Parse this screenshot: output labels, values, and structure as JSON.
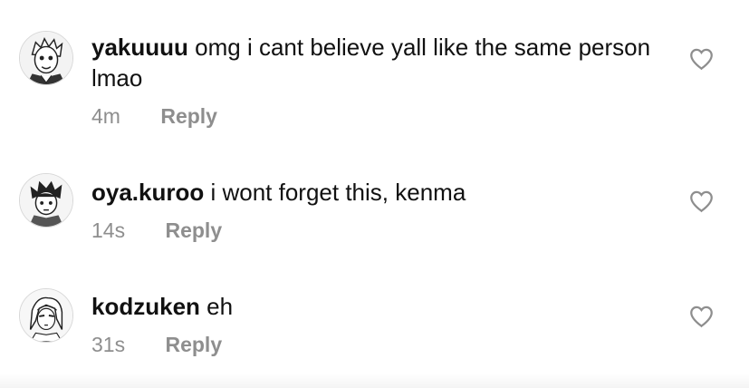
{
  "comments": [
    {
      "username": "yakuuuu",
      "text": "omg i cant believe yall like the same person lmao",
      "time": "4m",
      "reply_label": "Reply",
      "avatar_icon": "anime-avatar-icon",
      "like_icon": "heart-outline-icon"
    },
    {
      "username": "oya.kuroo",
      "text": "i wont forget this, kenma",
      "time": "14s",
      "reply_label": "Reply",
      "avatar_icon": "anime-avatar-icon",
      "like_icon": "heart-outline-icon"
    },
    {
      "username": "kodzuken",
      "text": "eh",
      "time": "31s",
      "reply_label": "Reply",
      "avatar_icon": "anime-avatar-icon",
      "like_icon": "heart-outline-icon"
    }
  ],
  "colors": {
    "text": "#111111",
    "meta": "#8e8e8e",
    "heart": "#8e8e8e"
  }
}
